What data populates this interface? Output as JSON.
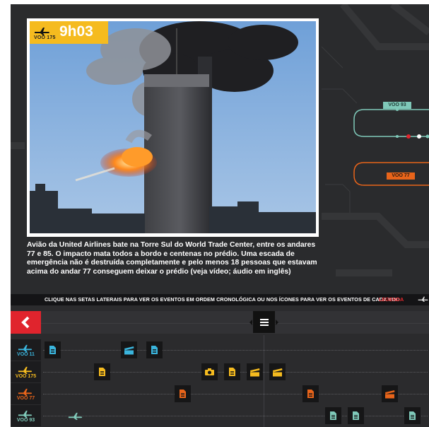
{
  "photo": {
    "flight": "VOO 175",
    "time": "9h03",
    "caption": "Avião da United Airlines bate na Torre Sul do World Trade Center, entre os andares 77 e 85. O impacto mata todos a bordo e centenas no prédio. Uma escada de emergência não é destruída completamente e pelo menos 18 pessoas que estavam acima do andar 77 conseguem deixar o prédio (veja vídeo; áudio em inglês)"
  },
  "map": {
    "tags": [
      {
        "label": "VOO 93",
        "color": "#7fc9b9"
      },
      {
        "label": "VOO 77",
        "color": "#e8641a"
      }
    ]
  },
  "instructions": {
    "text": "CLIQUE NAS SETAS LATERAIS PARA VER OS EVENTOS EM ORDEM CRONOLÓGICA OU NOS ÍCONES PARA VER OS EVENTOS DE CADA VOO",
    "legend": "LEGENDA"
  },
  "timeline": {
    "flights": [
      {
        "name": "VOO 11",
        "color": "#3ab4dc",
        "events": [
          {
            "type": "document-icon",
            "slot": 0
          },
          {
            "type": "clapper-icon",
            "slot": 4
          },
          {
            "type": "document-icon",
            "slot": 5
          }
        ]
      },
      {
        "name": "VOO 175",
        "color": "#f5bb1f",
        "events": [
          {
            "type": "document-icon",
            "slot": 2
          },
          {
            "type": "camera-icon",
            "slot": 8
          },
          {
            "type": "document-icon",
            "slot": 9
          },
          {
            "type": "clapper-icon",
            "slot": 10
          },
          {
            "type": "clapper-icon",
            "slot": 11
          }
        ]
      },
      {
        "name": "VOO 77",
        "color": "#e8641a",
        "events": [
          {
            "type": "document-icon",
            "slot": 6
          },
          {
            "type": "document-icon",
            "slot": 13
          },
          {
            "type": "clapper-icon",
            "slot": 16
          }
        ]
      },
      {
        "name": "VOO 93",
        "color": "#7fc9b9",
        "events": [
          {
            "type": "plane-icon",
            "slot": 1
          },
          {
            "type": "document-icon",
            "slot": 14
          },
          {
            "type": "document-icon",
            "slot": 15
          },
          {
            "type": "document-icon",
            "slot": 17
          }
        ]
      }
    ]
  }
}
